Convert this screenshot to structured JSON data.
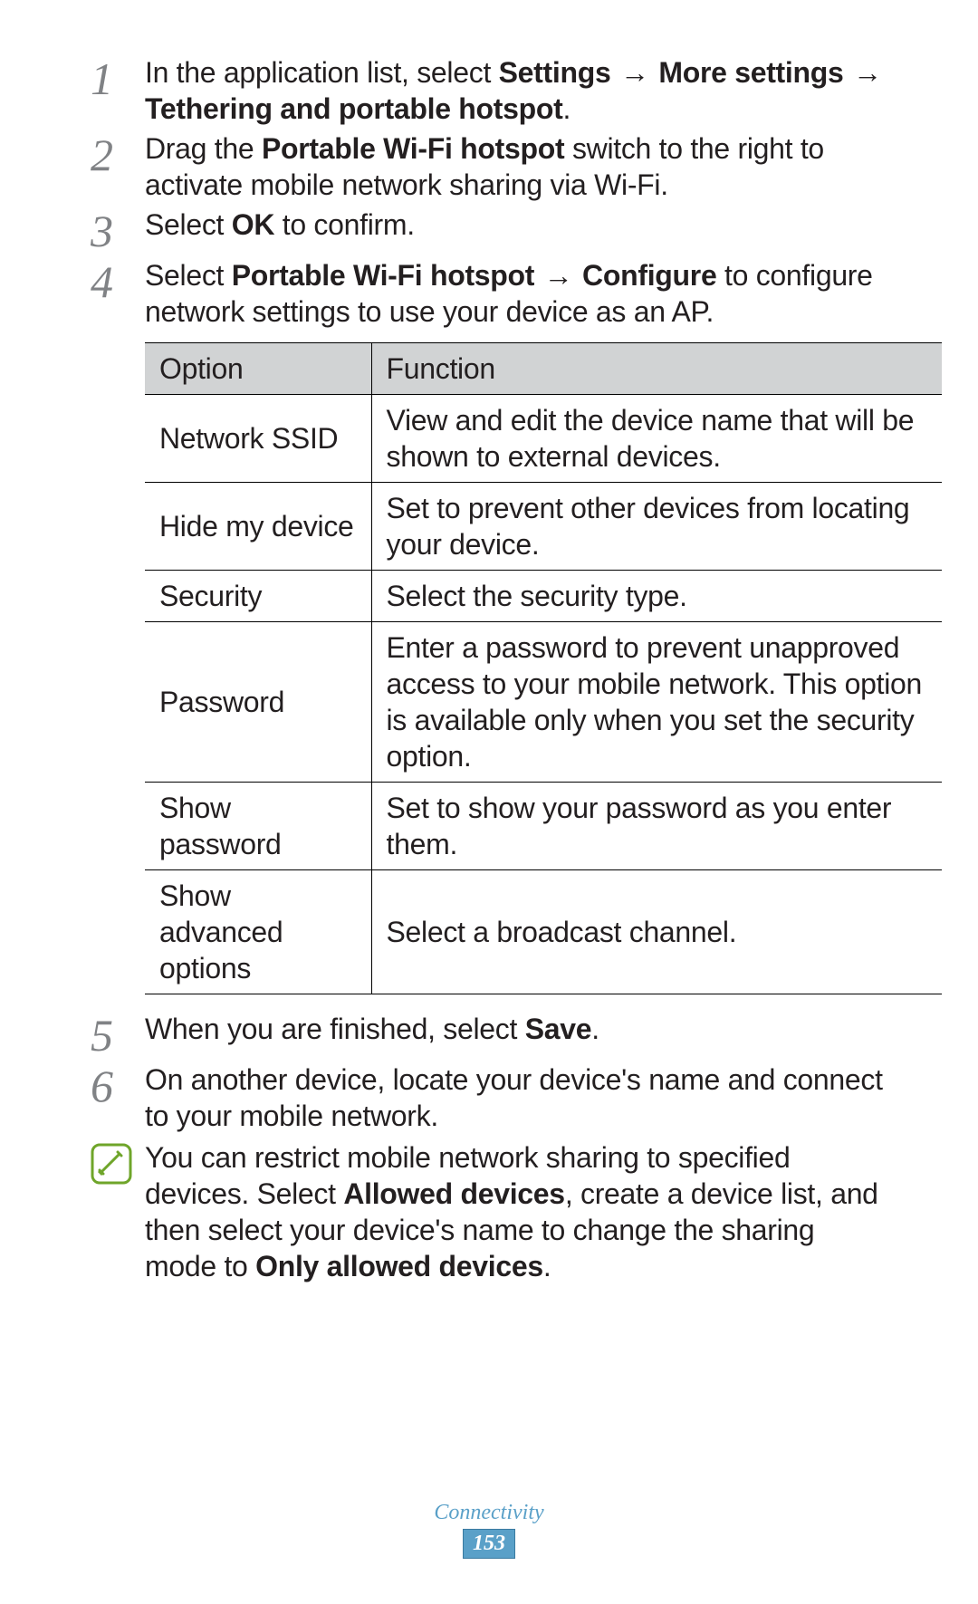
{
  "steps": [
    {
      "num": "1",
      "parts": [
        {
          "t": "In the application list, select "
        },
        {
          "t": "Settings",
          "b": true
        },
        {
          "t": " → ",
          "arrow": true
        },
        {
          "t": "More settings",
          "b": true
        },
        {
          "t": " → ",
          "arrow": true
        },
        {
          "t": "Tethering and portable hotspot",
          "b": true
        },
        {
          "t": "."
        }
      ]
    },
    {
      "num": "2",
      "parts": [
        {
          "t": "Drag the "
        },
        {
          "t": "Portable Wi-Fi hotspot",
          "b": true
        },
        {
          "t": " switch to the right to activate mobile network sharing via Wi-Fi."
        }
      ]
    },
    {
      "num": "3",
      "parts": [
        {
          "t": "Select "
        },
        {
          "t": "OK",
          "b": true
        },
        {
          "t": " to confirm."
        }
      ]
    },
    {
      "num": "4",
      "parts": [
        {
          "t": "Select "
        },
        {
          "t": "Portable Wi-Fi hotspot",
          "b": true
        },
        {
          "t": " → ",
          "arrow": true
        },
        {
          "t": "Configure",
          "b": true
        },
        {
          "t": " to configure network settings to use your device as an AP."
        }
      ]
    }
  ],
  "table": {
    "headers": [
      "Option",
      "Function"
    ],
    "rows": [
      [
        "Network SSID",
        "View and edit the device name that will be shown to external devices."
      ],
      [
        "Hide my device",
        "Set to prevent other devices from locating your device."
      ],
      [
        "Security",
        "Select the security type."
      ],
      [
        "Password",
        "Enter a password to prevent unapproved access to your mobile network. This option is available only when you set the security option."
      ],
      [
        "Show password",
        "Set to show your password as you enter them."
      ],
      [
        "Show advanced options",
        "Select a broadcast channel."
      ]
    ]
  },
  "steps2": [
    {
      "num": "5",
      "parts": [
        {
          "t": "When you are finished, select "
        },
        {
          "t": "Save",
          "b": true
        },
        {
          "t": "."
        }
      ]
    },
    {
      "num": "6",
      "parts": [
        {
          "t": "On another device, locate your device's name and connect to your mobile network."
        }
      ]
    }
  ],
  "note": {
    "parts": [
      {
        "t": "You can restrict mobile network sharing to specified devices. Select "
      },
      {
        "t": "Allowed devices",
        "b": true
      },
      {
        "t": ", create a device list, and then select your device's name to change the sharing mode to "
      },
      {
        "t": "Only allowed devices",
        "b": true
      },
      {
        "t": "."
      }
    ]
  },
  "footer": {
    "section": "Connectivity",
    "page": "153"
  }
}
